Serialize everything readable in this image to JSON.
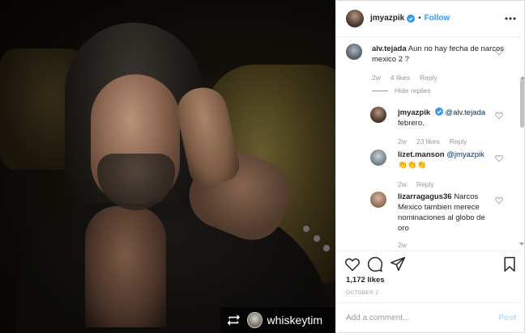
{
  "header": {
    "username": "jmyazpik",
    "dot": "•",
    "follow_label": "Follow"
  },
  "comments": [
    {
      "user": "alv.tejada",
      "text": "Aun no hay fecha de narcos mexico 2 ?",
      "time": "2w",
      "likes": "4 likes",
      "reply": "Reply"
    },
    {
      "hide_replies": "Hide replies"
    },
    {
      "user": "jmyazpik",
      "mention": "@alv.tejada",
      "text": "febrero.",
      "time": "2w",
      "likes": "23 likes",
      "reply": "Reply"
    },
    {
      "user": "lizet.manson",
      "mention": "@jmyazpik",
      "text": "👏👏👏",
      "time": "2w",
      "reply": "Reply"
    },
    {
      "user": "lizarragagus36",
      "text": "Narcos Mexico tambien merece nominaciones al globo de oro",
      "time": "2w"
    }
  ],
  "post": {
    "likes": "1,172 likes",
    "date": "OCTOBER 2"
  },
  "add_comment": {
    "placeholder": "Add a comment...",
    "post_label": "Post"
  },
  "repost": {
    "name": "whiskeytim"
  },
  "colors": {
    "accent": "#3897f0",
    "text": "#262626",
    "muted": "#999999",
    "post_disabled": "#b2dffc"
  }
}
